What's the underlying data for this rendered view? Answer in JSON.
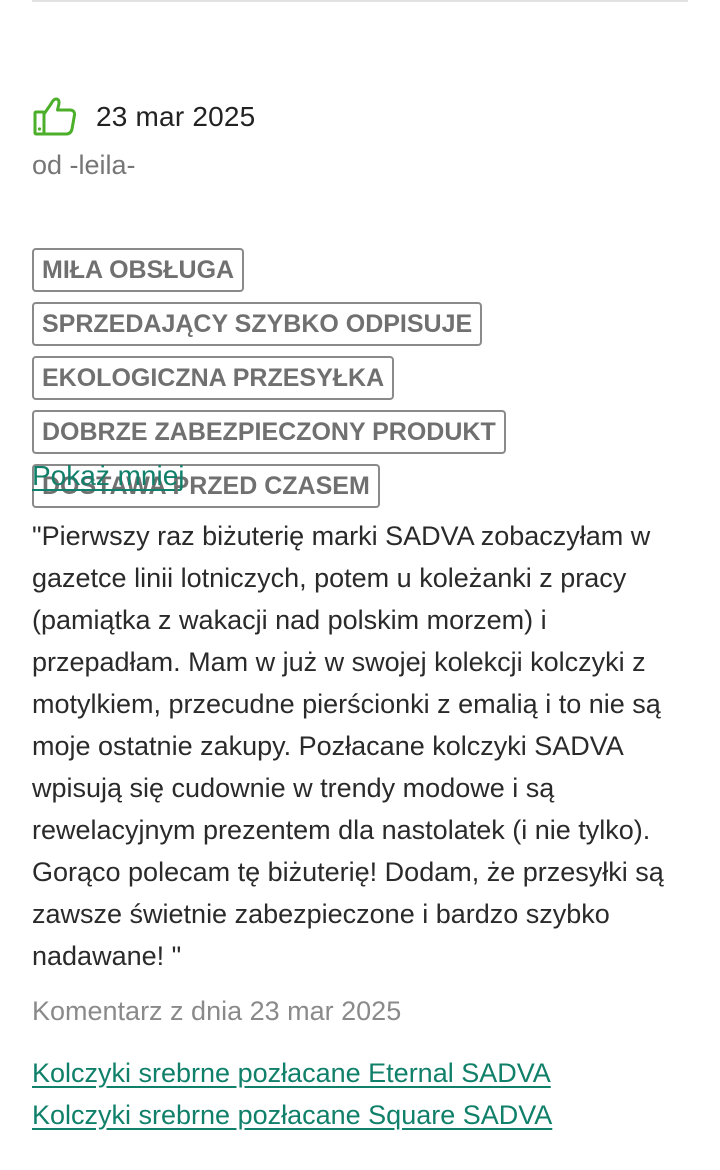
{
  "review": {
    "icon": "thumbs-up-icon",
    "icon_color": "#4caf2a",
    "date": "23 mar 2025",
    "author": "od -leila-",
    "tags": [
      "MIŁA OBSŁUGA",
      "SPRZEDAJĄCY SZYBKO ODPISUJE",
      "EKOLOGICZNA PRZESYŁKA",
      "DOBRZE ZABEZPIECZONY PRODUKT",
      "DOSTAWA PRZED CZASEM"
    ],
    "show_less_label": "Pokaż mniej",
    "text": "\"Pierwszy raz biżuterię marki SADVA zobaczyłam w gazetce linii lotniczych, potem u koleżanki z pracy (pamiątka z wakacji nad polskim morzem) i przepadłam. Mam w już w swojej kolekcji kolczyki z motylkiem, przecudne pierścionki z emalią i to nie są moje ostatnie zakupy. Pozłacane kolczyki SADVA wpisują się cudownie w trendy modowe i są rewelacyjnym prezentem dla nastolatek (i nie tylko). Gorąco polecam tę biżuterię! Dodam, że przesyłki są zawsze świetnie zabezpieczone i bardzo szybko nadawane! \"",
    "comment_date": "Komentarz z dnia 23 mar 2025",
    "product_links": [
      "Kolczyki srebrne pozłacane Eternal SADVA",
      "Kolczyki srebrne pozłacane Square SADVA"
    ],
    "link_color": "#11806a"
  }
}
